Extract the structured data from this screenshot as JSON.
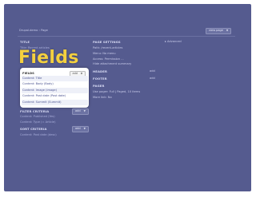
{
  "breadcrumb": {
    "home": "Drupal.demo",
    "separator": "›",
    "current": "Page"
  },
  "view_page_button": "view page",
  "title_section": {
    "heading": "TITLE",
    "value": "Title: Recent articles"
  },
  "fields_callout": "Fields",
  "fields_card": {
    "heading": "FIELDS",
    "add_label": "add",
    "items": [
      "Content: Title",
      "Content: Body (Body)",
      "Content: Image (image)",
      "Content: Post date (Post date)",
      "Content: Summit (Summit)"
    ]
  },
  "filter_criteria": {
    "heading": "FILTER CRITERIA",
    "add_label": "add",
    "items": [
      "Content: Published (Yes)",
      "Content: Type (= Article)"
    ]
  },
  "sort_criteria": {
    "heading": "SORT CRITERIA",
    "add_label": "add",
    "items": [
      "Content: Post date (desc)"
    ]
  },
  "page_settings": {
    "heading": "PAGE SETTINGS",
    "lines": [
      "Path: /recent-articles",
      "Menu: No menu",
      "Access: Permission ...",
      "Hide attachment summary"
    ]
  },
  "advanced_label": "▸ Advanced",
  "header": {
    "heading": "HEADER",
    "add_label": "add"
  },
  "footer": {
    "heading": "FOOTER",
    "add_label": "add"
  },
  "pager": {
    "heading": "PAGER",
    "lines": [
      "Use pager: Full  |  Paged, 10 items",
      "More link: No"
    ]
  },
  "colors": {
    "panel": "#555b8f",
    "accent_yellow": "#f4d03f",
    "link": "#4a5290"
  }
}
